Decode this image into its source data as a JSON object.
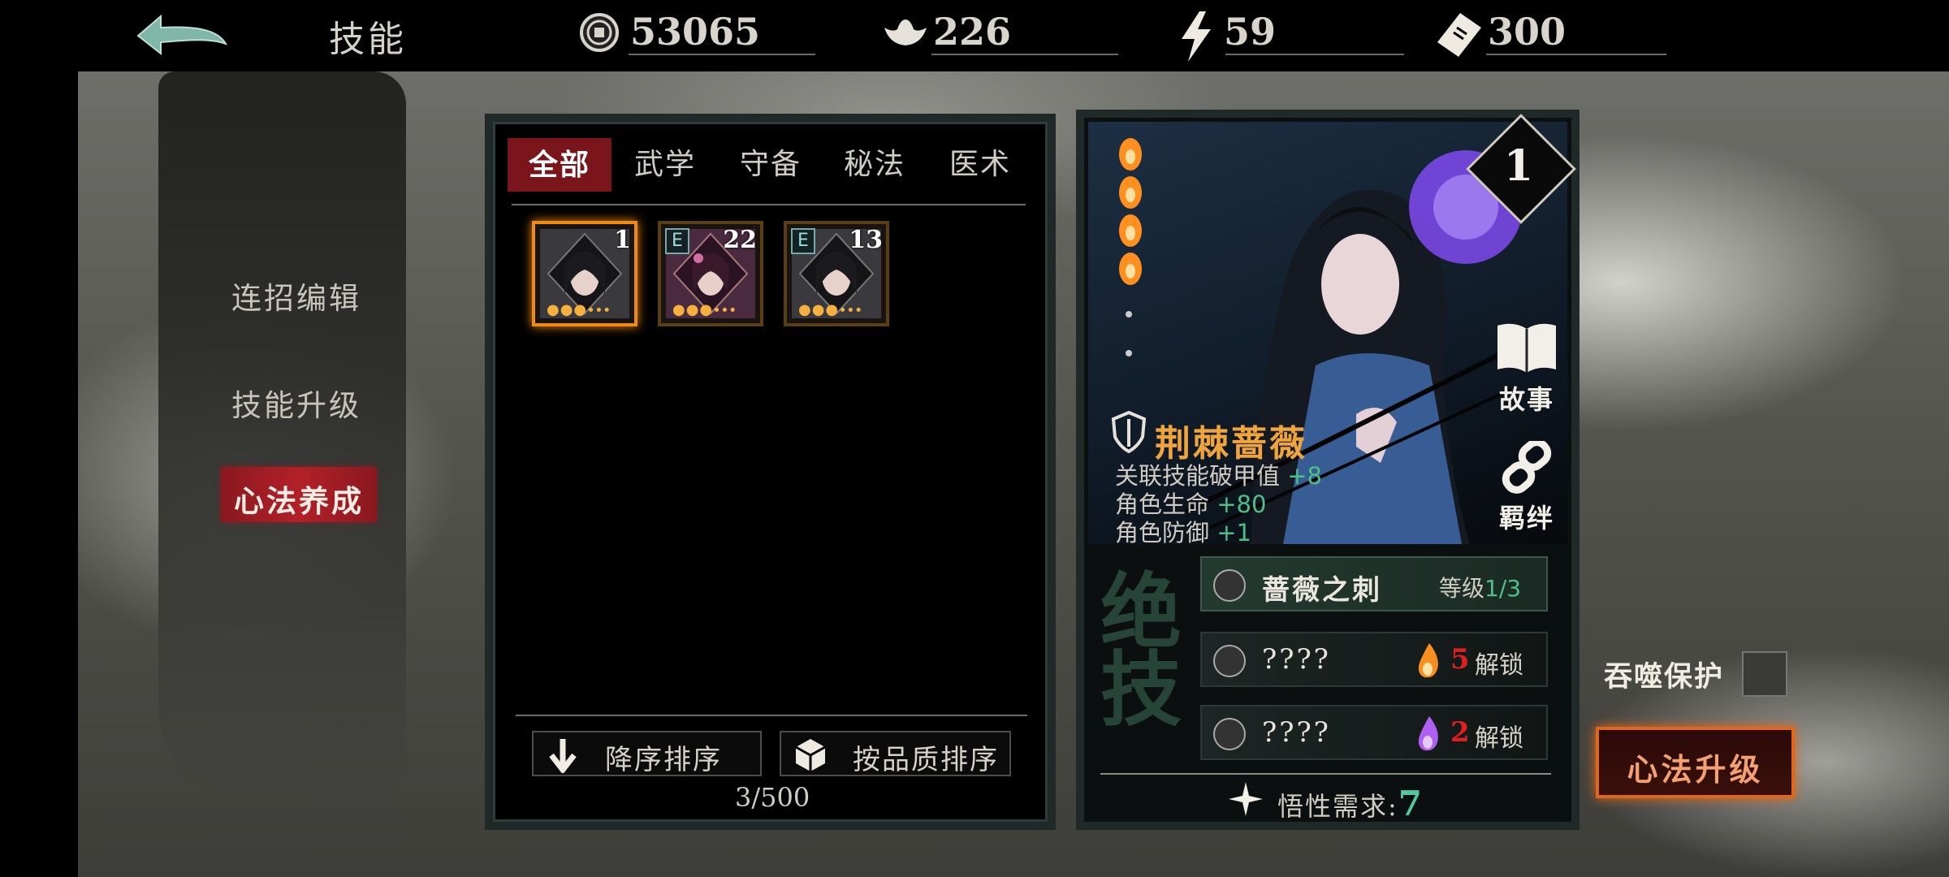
{
  "header": {
    "title": "技能",
    "resources": [
      {
        "icon": "coin-icon",
        "value": "53065"
      },
      {
        "icon": "silver-ingot-icon",
        "value": "226"
      },
      {
        "icon": "lightning-icon",
        "value": "59"
      },
      {
        "icon": "ticket-icon",
        "value": "300"
      }
    ]
  },
  "nav": {
    "items": [
      {
        "label": "连招编辑"
      },
      {
        "label": "技能升级"
      },
      {
        "label": "心法养成"
      }
    ]
  },
  "tabs": [
    "全部",
    "武学",
    "守备",
    "秘法",
    "医术"
  ],
  "cards": [
    {
      "level": "1",
      "badge": "",
      "selected": true
    },
    {
      "level": "22",
      "badge": "E",
      "selected": false
    },
    {
      "level": "13",
      "badge": "E",
      "selected": false
    }
  ],
  "sort": {
    "desc_label": "降序排序",
    "quality_label": "按品质排序",
    "count": "3/500"
  },
  "detail": {
    "rank": "1",
    "story_label": "故事",
    "bond_label": "羁绊",
    "name": "荆棘蔷薇",
    "stats": [
      {
        "label": "关联技能破甲值",
        "value": "+8"
      },
      {
        "label": "角色生命",
        "value": "+80"
      },
      {
        "label": "角色防御",
        "value": "+1"
      }
    ],
    "big_text": "绝技",
    "skill": {
      "name": "蔷薇之刺",
      "level_label": "等级",
      "level_value": "1/3"
    },
    "locked": [
      {
        "name": "????",
        "cost": "5",
        "label": "解锁",
        "flame_color": "#f59020"
      },
      {
        "name": "????",
        "cost": "2",
        "label": "解锁",
        "flame_color": "#b060f0"
      }
    ],
    "req_label": "悟性需求:",
    "req_value": "7"
  },
  "devour_label": "吞噬保护",
  "upgrade_label": "心法升级",
  "colors": {
    "accent_red": "#b32028",
    "orange": "#f0a43c",
    "green": "#4fbf8a"
  }
}
